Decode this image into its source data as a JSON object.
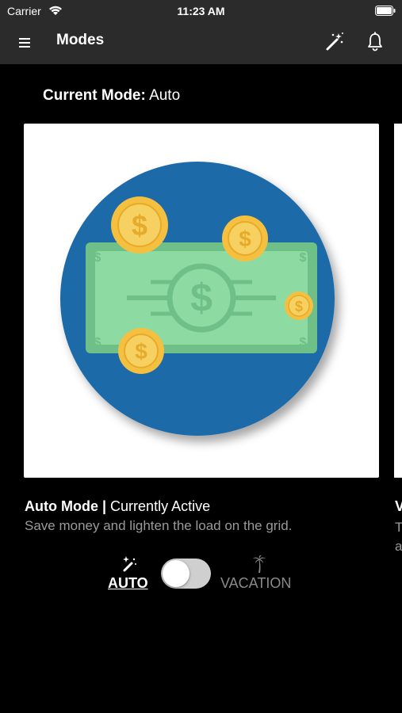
{
  "status_bar": {
    "carrier": "Carrier",
    "time": "11:23 AM"
  },
  "nav": {
    "title": "Modes",
    "icons": [
      "menu-icon",
      "magic-wand-icon",
      "bell-icon"
    ]
  },
  "current_mode": {
    "label": "Current Mode:",
    "value": "Auto"
  },
  "cards": [
    {
      "title_name": "Auto Mode |",
      "title_status": "Currently Active",
      "description": "Save money and lighten the load on the grid.",
      "image": "money-illustration"
    },
    {
      "title_partial": "V",
      "description_partial": "T\na"
    }
  ],
  "mode_switch": {
    "left_label": "AUTO",
    "right_label": "VACATION",
    "selected": "AUTO",
    "left_icon": "magic-wand-icon",
    "right_icon": "palm-tree-icon"
  },
  "colors": {
    "bar_bg": "#2b2b2b",
    "circle_blue": "#1e6aa8",
    "bill_green": "#7fcf95",
    "coin_gold": "#f5c040"
  }
}
